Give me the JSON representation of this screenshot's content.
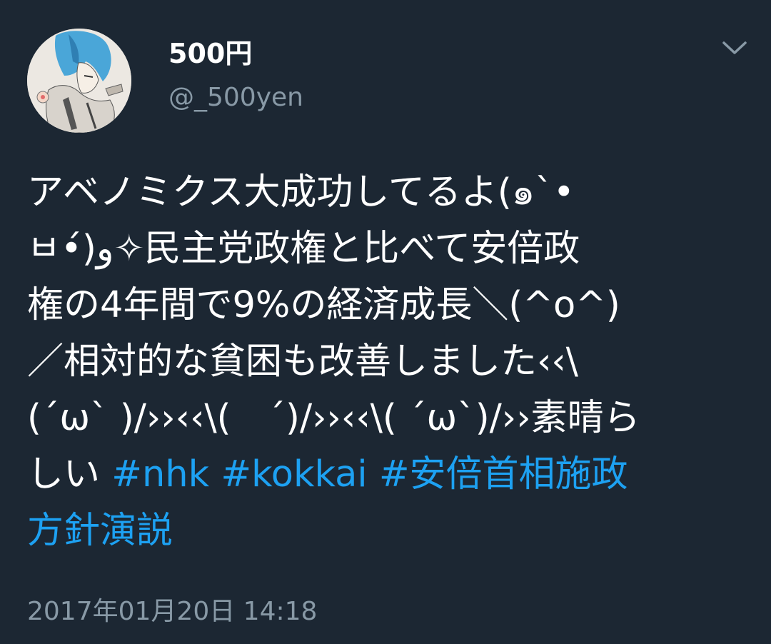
{
  "user": {
    "display_name": "500円",
    "handle": "@_500yen",
    "avatar_icon": "anime-avatar"
  },
  "menu": {
    "icon": "chevron-down-icon"
  },
  "tweet": {
    "lines": [
      "アベノミクス大成功してるよ(๑`•",
      "ㅂ•́)و✧民主党政権と比べて安倍政",
      "権の4年間で9%の経済成長＼(^o^)",
      "／相対的な貧困も改善しました‹‹\\",
      "(´ω` )/››‹‹\\(　´)/››‹‹\\( ´ω`)/››素晴ら"
    ],
    "last_line_text": "しい ",
    "hashtags": [
      "#nhk",
      "#kokkai",
      "#安倍首相施政",
      "方針演説"
    ],
    "timestamp": "2017年01月20日 14:18"
  },
  "colors": {
    "background": "#1c2733",
    "text": "#ffffff",
    "secondary": "#8899a6",
    "link": "#1da1f2"
  }
}
